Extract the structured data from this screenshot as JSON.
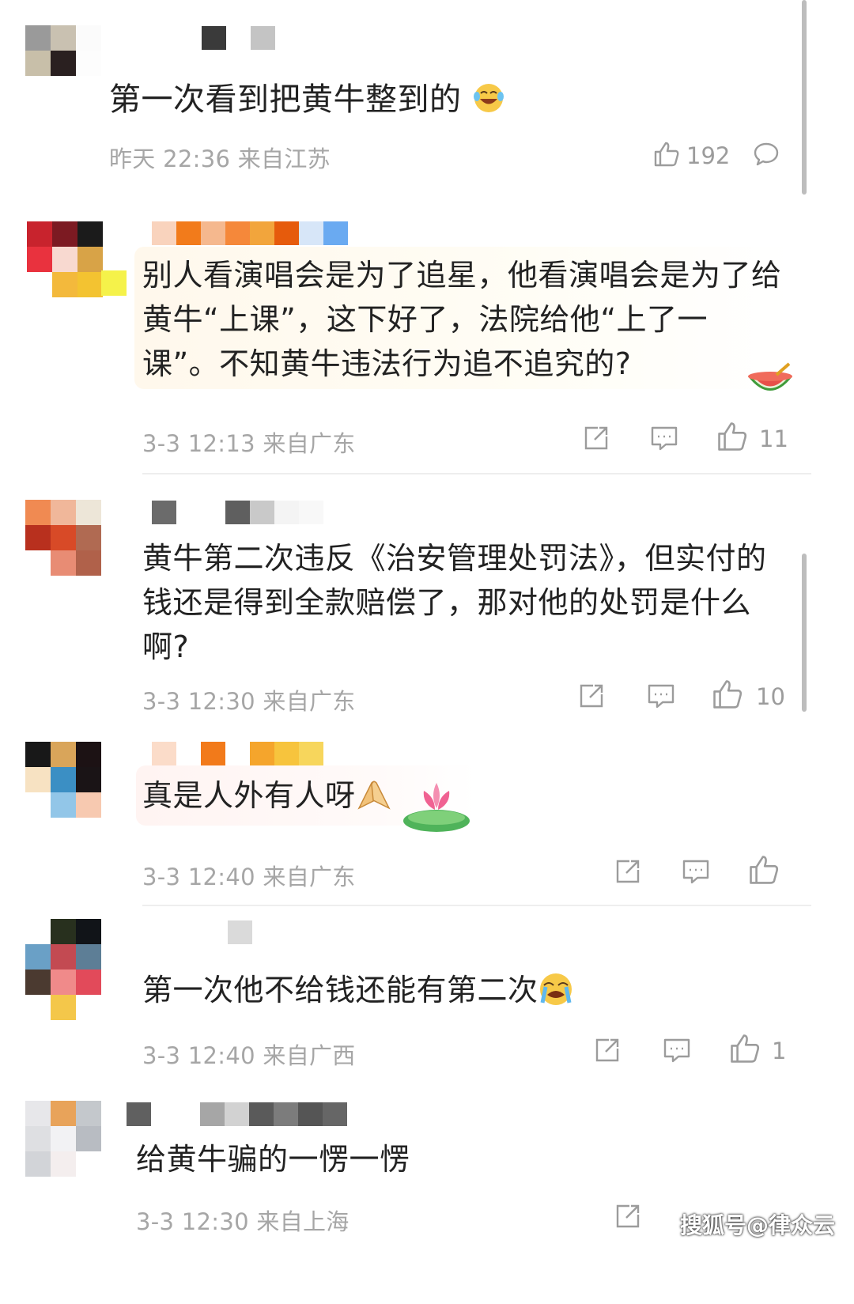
{
  "comments": [
    {
      "text": "第一次看到把黄牛整到的",
      "time": "昨天 22:36",
      "location": "来自江苏",
      "likes": "192"
    },
    {
      "text": "别人看演唱会是为了追星，他看演唱会是为了给黄牛“上课”，这下好了，法院给他“上了一课”。不知黄牛违法行为追不追究的?",
      "line1": "别人看演唱会是为了追星，他看演唱会是为了给",
      "line2": "黄牛“上课”，这下好了，法院给他“上了一",
      "line3": "课”。不知黄牛违法行为追不追究的?",
      "time": "3-3 12:13",
      "location": "来自广东",
      "likes": "11"
    },
    {
      "text": "黄牛第二次违反《治安管理处罚法》，但实付的钱还是得到全款赔偿了，那对他的处罚是什么啊?",
      "line1": "黄牛第二次违反《治安管理处罚法》，但实付的",
      "line2": "钱还是得到全款赔偿了，那对他的处罚是什么",
      "line3": "啊?",
      "time": "3-3 12:30",
      "location": "来自广东",
      "likes": "10"
    },
    {
      "text": "真是人外有人呀",
      "time": "3-3 12:40",
      "location": "来自广东",
      "likes": ""
    },
    {
      "text": "第一次他不给钱还能有第二次",
      "time": "3-3 12:40",
      "location": "来自广西",
      "likes": "1"
    },
    {
      "text": "给黄牛骗的一愣一愣",
      "time": "3-3 12:30",
      "location": "来自上海",
      "likes": ""
    }
  ],
  "watermark": "搜狐号@律众云",
  "icons": [
    "thumb-up-icon",
    "comment-bubble-icon",
    "share-icon",
    "reply-icon",
    "laugh-cry-emoji",
    "watermelon-emoji",
    "pray-hands-emoji",
    "lotus-emoji",
    "sob-emoji"
  ],
  "colors": {
    "meta_gray": "#a6a6a6",
    "text": "#222222",
    "divider": "#eeeeee"
  }
}
